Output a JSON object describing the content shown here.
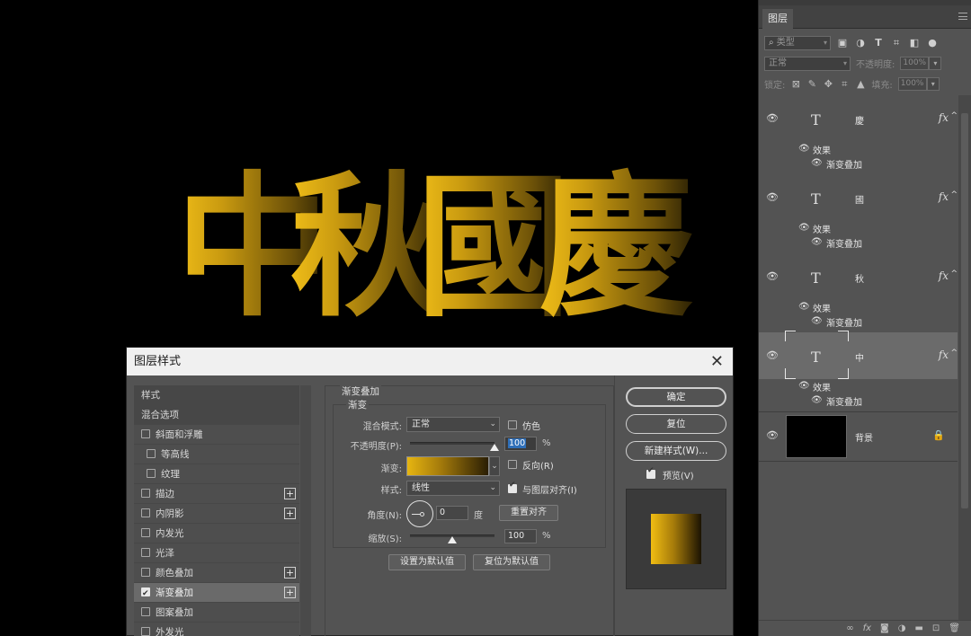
{
  "canvas": {
    "artwork_chars": [
      "中",
      "秋",
      "國",
      "慶"
    ]
  },
  "layers_panel": {
    "tab_label": "图层",
    "filter_select": "类型",
    "blend_mode": "正常",
    "opacity_label": "不透明度:",
    "opacity_value": "100%",
    "lock_label": "锁定:",
    "fill_label": "填充:",
    "fill_value": "100%",
    "layers": [
      {
        "type_glyph": "T",
        "name": "慶",
        "fx": "fx",
        "effects_label": "效果",
        "effect": "渐变叠加"
      },
      {
        "type_glyph": "T",
        "name": "國",
        "fx": "fx",
        "effects_label": "效果",
        "effect": "渐变叠加"
      },
      {
        "type_glyph": "T",
        "name": "秋",
        "fx": "fx",
        "effects_label": "效果",
        "effect": "渐变叠加"
      },
      {
        "type_glyph": "T",
        "name": "中",
        "fx": "fx",
        "effects_label": "效果",
        "effect": "渐变叠加",
        "selected": true
      }
    ],
    "background_layer": {
      "name": "背景"
    },
    "footer_icons": [
      "link-icon",
      "fx-icon",
      "mask-icon",
      "adjustment-icon",
      "folder-icon",
      "new-layer-icon",
      "trash-icon"
    ]
  },
  "dialog": {
    "title": "图层样式",
    "style_list": [
      {
        "label": "样式",
        "kind": "head"
      },
      {
        "label": "混合选项",
        "kind": "head"
      },
      {
        "label": "斜面和浮雕",
        "checked": false
      },
      {
        "label": "等高线",
        "checked": false,
        "sub": true
      },
      {
        "label": "纹理",
        "checked": false,
        "sub": true
      },
      {
        "label": "描边",
        "checked": false,
        "plus": true
      },
      {
        "label": "内阴影",
        "checked": false,
        "plus": true
      },
      {
        "label": "内发光",
        "checked": false
      },
      {
        "label": "光泽",
        "checked": false
      },
      {
        "label": "颜色叠加",
        "checked": false,
        "plus": true
      },
      {
        "label": "渐变叠加",
        "checked": true,
        "plus": true,
        "active": true
      },
      {
        "label": "图案叠加",
        "checked": false
      },
      {
        "label": "外发光",
        "checked": false
      }
    ],
    "section_title": "渐变叠加",
    "group_title": "渐变",
    "blend_mode_label": "混合模式:",
    "blend_mode_value": "正常",
    "dither_label": "仿色",
    "opacity_label": "不透明度(P):",
    "opacity_value": "100",
    "percent": "%",
    "gradient_label": "渐变:",
    "reverse_label": "反向(R)",
    "style_label": "样式:",
    "style_value": "线性",
    "align_label": "与图层对齐(I)",
    "angle_label": "角度(N):",
    "angle_value": "0",
    "degree": "度",
    "reset_align": "重置对齐",
    "scale_label": "缩放(S):",
    "scale_value": "100",
    "set_default": "设置为默认值",
    "reset_default": "复位为默认值",
    "ok": "确定",
    "reset": "复位",
    "new_style": "新建样式(W)...",
    "preview_label": "预览(V)",
    "opacity_level": 1.0,
    "scale_level": 0.5
  }
}
